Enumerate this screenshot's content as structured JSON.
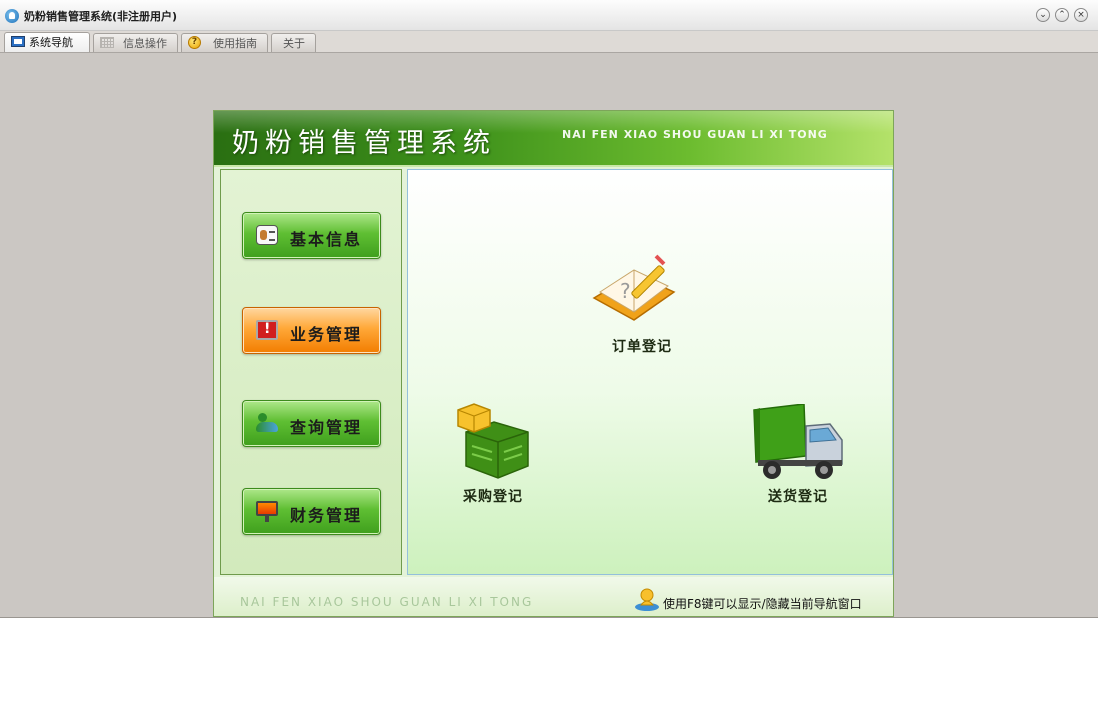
{
  "window": {
    "title": "奶粉销售管理系统(非注册用户)",
    "controls": [
      "minimize",
      "maximize",
      "close"
    ]
  },
  "tabs": [
    {
      "label": "系统导航",
      "icon": "monitor-icon",
      "active": true
    },
    {
      "label": "信息操作",
      "icon": "grid-icon",
      "active": false
    },
    {
      "label": "使用指南",
      "icon": "help-icon",
      "active": false
    },
    {
      "label": "关于",
      "icon": "",
      "active": false
    }
  ],
  "banner": {
    "title": "奶粉销售管理系统",
    "subtitle": "NAI FEN XIAO SHOU GUAN LI XI TONG"
  },
  "nav": [
    {
      "label": "基本信息",
      "icon": "id-card-icon",
      "active": false
    },
    {
      "label": "业务管理",
      "icon": "alert-computer-icon",
      "active": true
    },
    {
      "label": "查询管理",
      "icon": "people-icon",
      "active": false
    },
    {
      "label": "财务管理",
      "icon": "presentation-board-icon",
      "active": false
    }
  ],
  "items": {
    "order": {
      "label": "订单登记",
      "icon": "notebook-pencil-icon"
    },
    "purchase": {
      "label": "采购登记",
      "icon": "stacked-boxes-icon"
    },
    "delivery": {
      "label": "送货登记",
      "icon": "delivery-truck-icon"
    }
  },
  "footer": {
    "subtitle": "NAI FEN XIAO SHOU GUAN LI XI TONG",
    "tip": "使用F8键可以显示/隐藏当前导航窗口"
  },
  "colors": {
    "accent_green": "#3c8f1a",
    "active_orange": "#f27d00",
    "window_bg": "#cbc7c3"
  }
}
